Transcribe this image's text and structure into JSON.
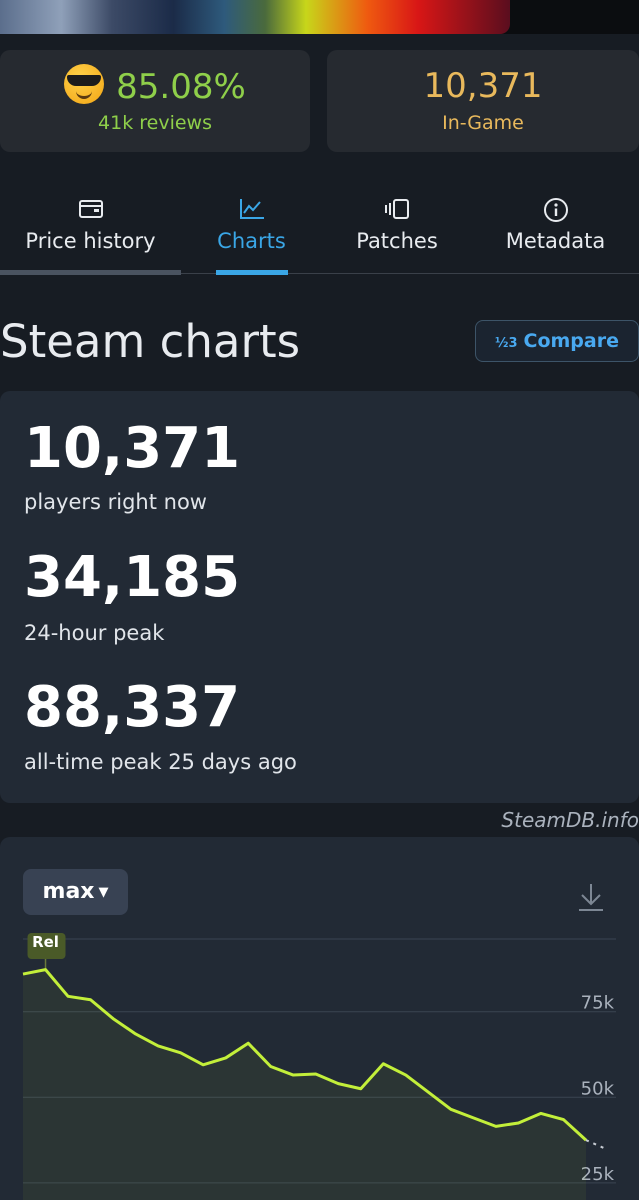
{
  "stats": {
    "rating": "85.08%",
    "reviews": "41k reviews",
    "ingame_count": "10,371",
    "ingame_label": "In-Game"
  },
  "tabs": [
    {
      "label": "Price history",
      "icon": "wallet-icon"
    },
    {
      "label": "Charts",
      "icon": "line-chart-icon",
      "active": true
    },
    {
      "label": "Patches",
      "icon": "patches-icon"
    },
    {
      "label": "Metadata",
      "icon": "info-icon"
    }
  ],
  "section": {
    "title": "Steam charts",
    "compare_label": "Compare"
  },
  "players": [
    {
      "value": "10,371",
      "label": "players right now"
    },
    {
      "value": "34,185",
      "label": "24-hour peak"
    },
    {
      "value": "88,337",
      "label": "all-time peak 25 days ago"
    }
  ],
  "credit": "SteamDB.info",
  "chart": {
    "range_label": "max",
    "release_label": "Rel",
    "y_ticks": [
      "75k",
      "50k",
      "25k"
    ],
    "line_color": "#c3ef3a"
  },
  "chart_data": {
    "type": "line",
    "x": [
      0,
      1,
      2,
      3,
      4,
      5,
      6,
      7,
      8,
      9,
      10,
      11,
      12,
      13,
      14,
      15,
      16,
      17,
      18,
      19,
      20,
      21,
      22,
      23,
      24,
      25
    ],
    "series": [
      {
        "values": [
          86000,
          87300,
          79500,
          78500,
          73000,
          68500,
          65000,
          63000,
          59500,
          61500,
          65800,
          59000,
          56500,
          56800,
          54000,
          52500,
          59800,
          56500,
          51500,
          46500,
          44000,
          41500,
          42500,
          45300,
          43500,
          37500
        ]
      }
    ],
    "y_ticks": [
      75000,
      50000,
      25000
    ],
    "ylim": [
      20000,
      98000
    ],
    "grid": true,
    "annotations": [
      "Rel"
    ]
  }
}
